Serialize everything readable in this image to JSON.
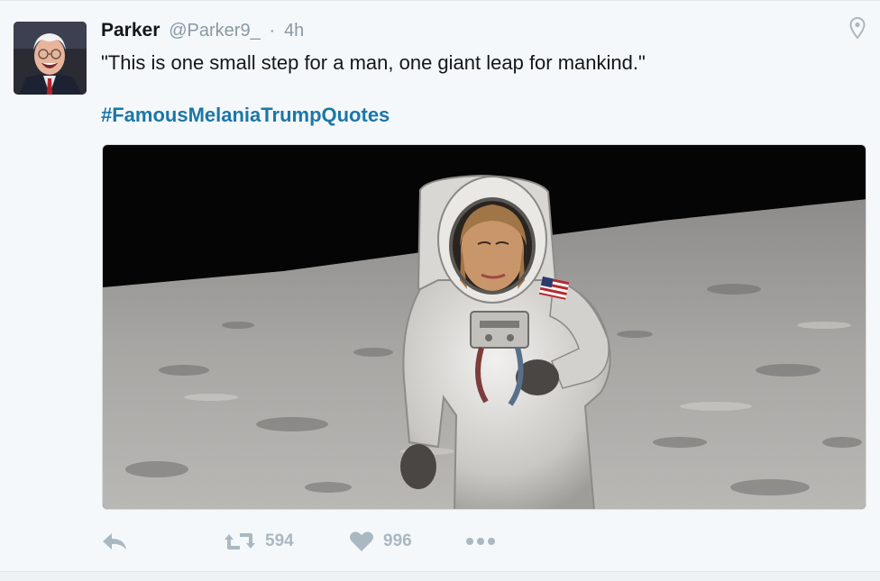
{
  "tweet": {
    "fullname": "Parker",
    "username": "@Parker9_",
    "separator": "·",
    "timestamp": "4h",
    "text": "\"This is one small step for a man, one giant leap for mankind.\"",
    "hashtag": "#FamousMelaniaTrumpQuotes"
  },
  "actions": {
    "reply_icon": "reply-icon",
    "retweet_icon": "retweet-icon",
    "retweet_count": "594",
    "like_icon": "heart-icon",
    "like_count": "996",
    "more_icon": "more-icon"
  },
  "colors": {
    "hashtag": "#1b77a8",
    "muted": "#8899a6",
    "action_icons": "#aab8c2",
    "background": "#f5f8fa"
  }
}
